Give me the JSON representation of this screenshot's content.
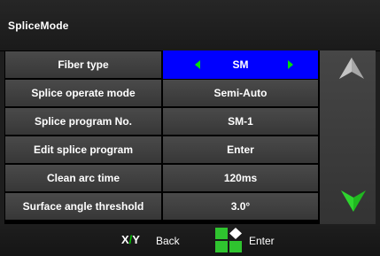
{
  "window": {
    "title": "SpliceMode"
  },
  "rows": [
    {
      "label": "Fiber type",
      "value": "SM",
      "selected": true
    },
    {
      "label": "Splice operate mode",
      "value": "Semi-Auto"
    },
    {
      "label": "Splice program No.",
      "value": "SM-1"
    },
    {
      "label": "Edit splice program",
      "value": "Enter"
    },
    {
      "label": "Clean arc time",
      "value": "120ms"
    },
    {
      "label": "Surface angle threshold",
      "value": "3.0°"
    }
  ],
  "footer": {
    "xy_x": "X",
    "xy_slash": "/",
    "xy_y": "Y",
    "back_label": "Back",
    "enter_label": "Enter"
  },
  "colors": {
    "selected_bg": "#0000ff",
    "accent_green": "#00c800",
    "up_arrow": "#a0a0a0",
    "down_arrow": "#1fb81f"
  },
  "icons": {
    "up": "up-arrow-icon",
    "down": "down-arrow-icon",
    "enter": "enter-keypad-icon"
  }
}
